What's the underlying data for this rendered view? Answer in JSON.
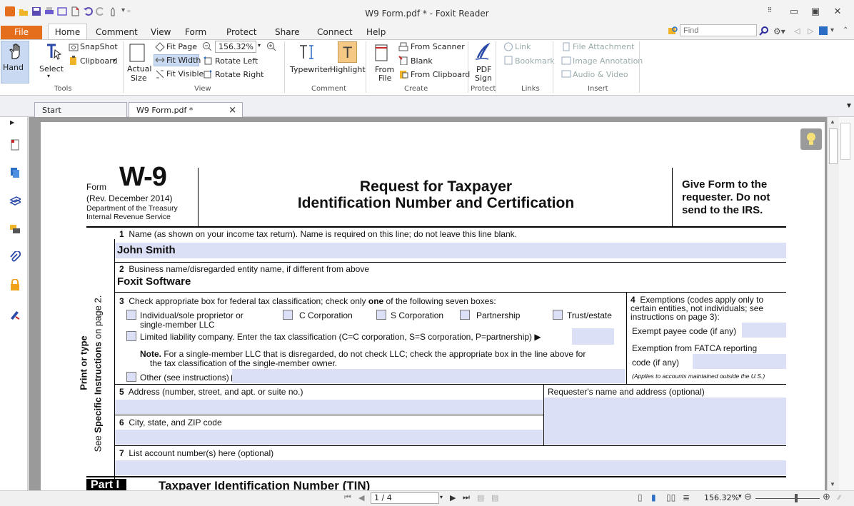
{
  "app": {
    "title": "W9 Form.pdf * - Foxit Reader",
    "find_placeholder": "Find"
  },
  "menu": {
    "file": "File",
    "items": [
      "Home",
      "Comment",
      "View",
      "Form",
      "Protect",
      "Share",
      "Connect",
      "Help"
    ]
  },
  "ribbon": {
    "tools": {
      "hand": "Hand",
      "select": "Select",
      "snapshot": "SnapShot",
      "clipboard": "Clipboard",
      "group": "Tools"
    },
    "view": {
      "actual_size_1": "Actual",
      "actual_size_2": "Size",
      "fit_page": "Fit Page",
      "fit_width": "Fit Width",
      "fit_visible": "Fit Visible",
      "zoom": "156.32%",
      "rotate_left": "Rotate Left",
      "rotate_right": "Rotate Right",
      "group": "View"
    },
    "comment": {
      "typewriter": "Typewriter",
      "highlight": "Highlight",
      "group": "Comment"
    },
    "create": {
      "from_file_1": "From",
      "from_file_2": "File",
      "from_scanner": "From Scanner",
      "blank": "Blank",
      "from_clipboard": "From Clipboard",
      "group": "Create"
    },
    "protect": {
      "pdf_sign_1": "PDF",
      "pdf_sign_2": "Sign",
      "group": "Protect"
    },
    "links": {
      "link": "Link",
      "bookmark": "Bookmark",
      "group": "Links"
    },
    "insert": {
      "file_attachment": "File Attachment",
      "image_annotation": "Image Annotation",
      "audio_video": "Audio & Video",
      "group": "Insert"
    }
  },
  "tabs": [
    {
      "label": "Start"
    },
    {
      "label": "W9 Form.pdf *",
      "close": "×"
    }
  ],
  "form": {
    "form_label": "Form",
    "form_number": "W-9",
    "rev": "(Rev. December 2014)",
    "dept": "Department of the Treasury",
    "irs": "Internal Revenue Service",
    "title_1": "Request for Taxpayer",
    "title_2": "Identification Number and Certification",
    "give_1": "Give Form to the",
    "give_2": "requester. Do not",
    "give_3": "send to the IRS.",
    "side_text_1": "Print or type",
    "side_text_2a": "See ",
    "side_text_2b": "Specific Instructions",
    "side_text_2c": " on page 2.",
    "line1_label": "Name (as shown on your income tax return). Name is required on this line; do not leave this line blank.",
    "line1_value": "John Smith",
    "line2_label": "Business name/disregarded entity name, if different from above",
    "line2_value": "Foxit Software",
    "line3_label_a": "Check appropriate box for federal tax classification; check only ",
    "line3_label_b": "one",
    "line3_label_c": " of the following seven boxes:",
    "cb_individual_1": "Individual/sole proprietor or",
    "cb_individual_2": "single-member LLC",
    "cb_ccorp": "C Corporation",
    "cb_scorp": "S Corporation",
    "cb_partnership": "Partnership",
    "cb_trust": "Trust/estate",
    "cb_llc": "Limited liability company. Enter the tax classification (C=C corporation, S=S corporation, P=partnership) ▶",
    "note_bold": "Note.",
    "note_1": " For a single-member LLC that is disregarded, do not check LLC; check the appropriate box in the line above for",
    "note_2": "the tax classification of the single-member owner.",
    "cb_other": "Other (see instructions) ▶",
    "ex_1": "Exemptions (codes apply only to",
    "ex_2": "certain entities, not individuals; see",
    "ex_3": "instructions on page 3):",
    "ex_payee": "Exempt payee code (if any)",
    "ex_fatca_1": "Exemption from FATCA reporting",
    "ex_fatca_2": "code (if any)",
    "ex_applies": "(Applies to accounts maintained outside the U.S.)",
    "line5_label": "Address (number, street, and apt. or suite no.)",
    "requester": "Requester's name and address (optional)",
    "line6_label": "City, state, and ZIP code",
    "line7_label": "List account number(s) here (optional)",
    "part_label": "Part I",
    "part_title": "Taxpayer Identification Number (TIN)",
    "n1": "1",
    "n2": "2",
    "n3": "3",
    "n4": "4",
    "n5": "5",
    "n6": "6",
    "n7": "7"
  },
  "status": {
    "page": "1 / 4",
    "zoom": "156.32%"
  },
  "colors": {
    "accent": "#e46e1c",
    "field": "#dbe0f7"
  }
}
